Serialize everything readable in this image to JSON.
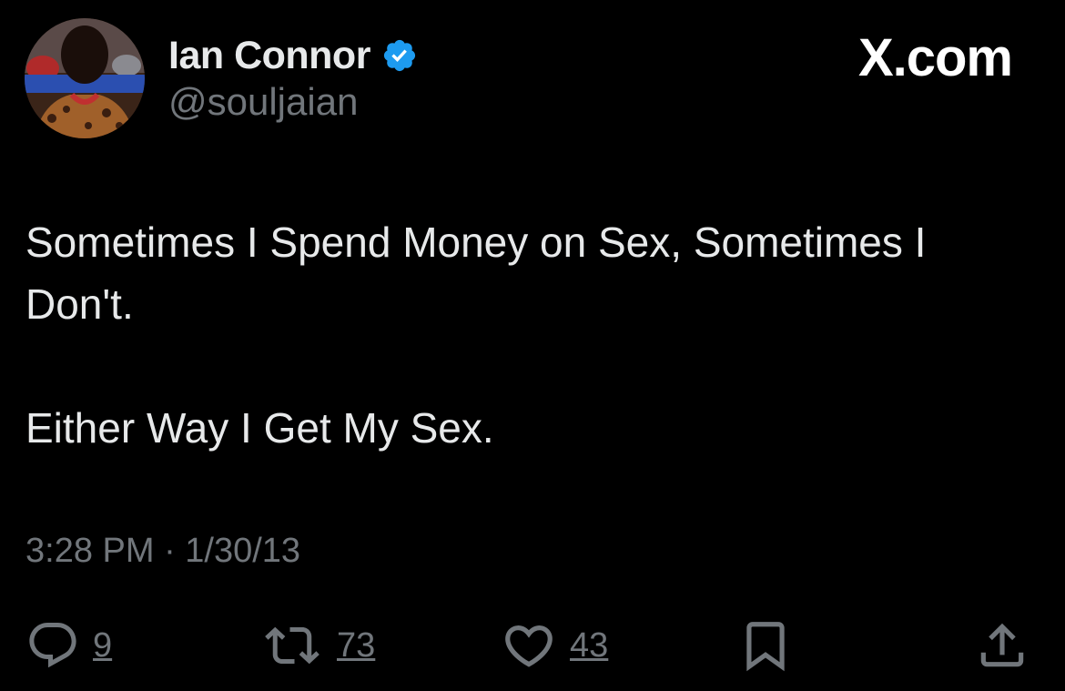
{
  "header": {
    "display_name": "Ian Connor",
    "handle": "@souljaian",
    "brand": "X.com"
  },
  "tweet": {
    "text": "Sometimes I Spend Money on Sex, Sometimes I\nDon't.\n\nEither Way I Get My Sex.",
    "timestamp": "3:28 PM · 1/30/13"
  },
  "actions": {
    "replies": "9",
    "reposts": "73",
    "likes": "43"
  },
  "icons": [
    "reply-icon",
    "repost-icon",
    "like-icon",
    "bookmark-icon",
    "share-icon",
    "verified-badge-icon"
  ],
  "colors": {
    "background": "#000000",
    "text": "#e7e9ea",
    "muted": "#71767b",
    "verified": "#1d9bf0"
  }
}
